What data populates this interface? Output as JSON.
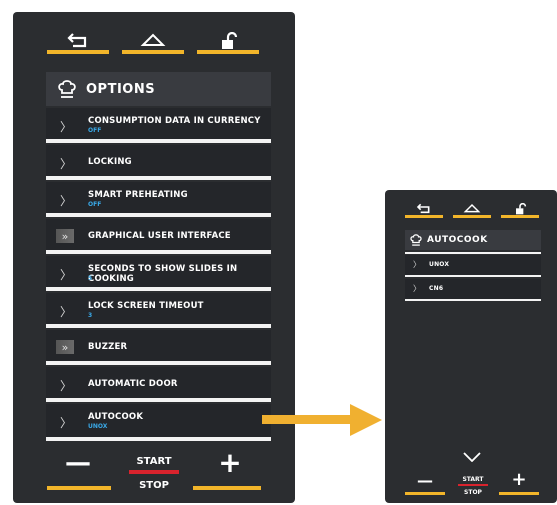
{
  "left_panel": {
    "header_title": "OPTIONS",
    "items": [
      {
        "label": "CONSUMPTION DATA IN CURRENCY",
        "value": "OFF"
      },
      {
        "label": "LOCKING",
        "value": ""
      },
      {
        "label": "SMART PREHEATING",
        "value": "OFF"
      },
      {
        "label": "GRAPHICAL USER INTERFACE",
        "value": ""
      },
      {
        "label": "SECONDS TO SHOW SLIDES IN COOKING",
        "value": "5"
      },
      {
        "label": "LOCK SCREEN TIMEOUT",
        "value": "3"
      },
      {
        "label": "BUZZER",
        "value": ""
      },
      {
        "label": "AUTOMATIC DOOR",
        "value": ""
      },
      {
        "label": "AUTOCOOK",
        "value": "UNOX"
      }
    ],
    "minus": "—",
    "plus": "+",
    "start": "START",
    "stop": "STOP"
  },
  "right_panel": {
    "header_title": "AUTOCOOK",
    "items": [
      {
        "label": "UNOX"
      },
      {
        "label": "CN6"
      }
    ],
    "minus": "—",
    "plus": "+",
    "start": "START",
    "stop": "STOP"
  },
  "colors": {
    "panel": "#2b2d30",
    "accent_yellow": "#f2b52a",
    "value_blue": "#39a9e8",
    "start_red": "#d9232d",
    "arrow": "#f0b030"
  },
  "icons": [
    "back-icon",
    "home-icon",
    "unlock-icon",
    "chef-hat-icon",
    "chevron-down-icon"
  ]
}
